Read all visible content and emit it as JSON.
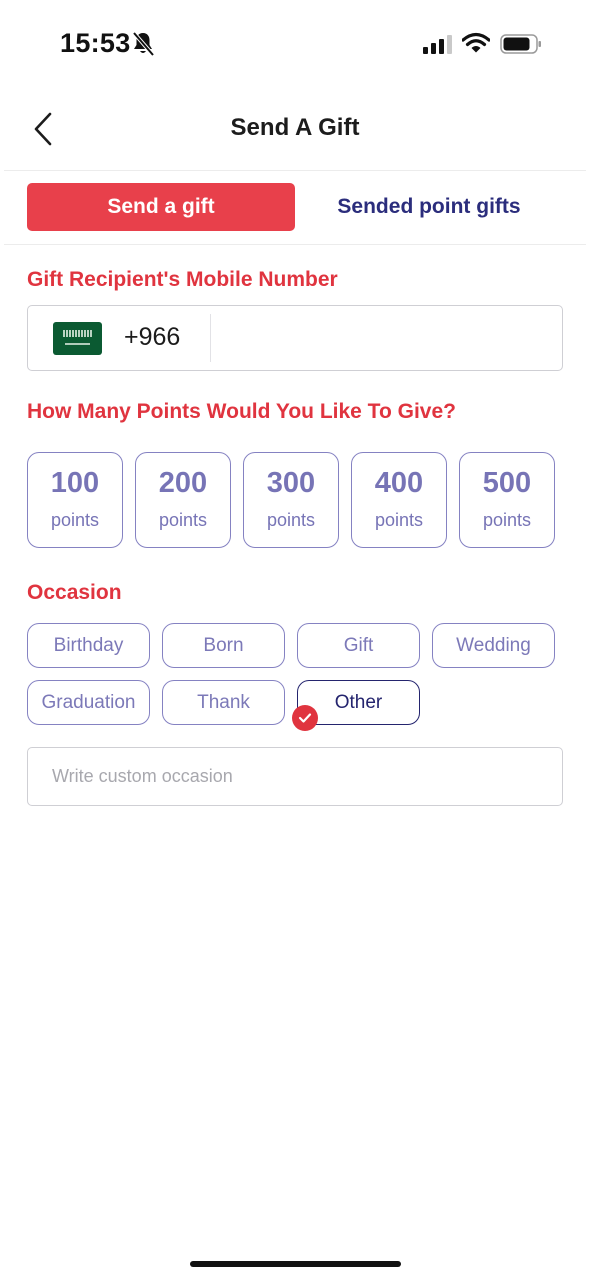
{
  "status_bar": {
    "time": "15:53",
    "icons": [
      "bell-slash-icon",
      "cellular-signal-icon",
      "wifi-icon",
      "battery-icon"
    ]
  },
  "header": {
    "title": "Send A Gift",
    "back_icon": "chevron-left-icon"
  },
  "tabs": [
    {
      "label": "Send a gift",
      "active": true
    },
    {
      "label": "Sended point gifts",
      "active": false
    }
  ],
  "recipient": {
    "label": "Gift Recipient's Mobile Number",
    "flag_icon": "saudi-arabia-flag-icon",
    "dial_code": "+966",
    "phone_value": ""
  },
  "points": {
    "label": "How Many Points Would You Like To Give?",
    "options": [
      {
        "value": "100",
        "unit": "points"
      },
      {
        "value": "200",
        "unit": "points"
      },
      {
        "value": "300",
        "unit": "points"
      },
      {
        "value": "400",
        "unit": "points"
      },
      {
        "value": "500",
        "unit": "points"
      }
    ]
  },
  "occasion": {
    "label": "Occasion",
    "options": [
      "Birthday",
      "Born",
      "Gift",
      "Wedding",
      "Graduation",
      "Thank",
      "Other"
    ],
    "selected": "Other",
    "custom_placeholder": "Write custom occasion",
    "custom_value": ""
  },
  "colors": {
    "accent_red": "#e8404b",
    "label_red": "#e0343f",
    "navy": "#2b2d7c",
    "chip_purple": "#8582c2"
  }
}
